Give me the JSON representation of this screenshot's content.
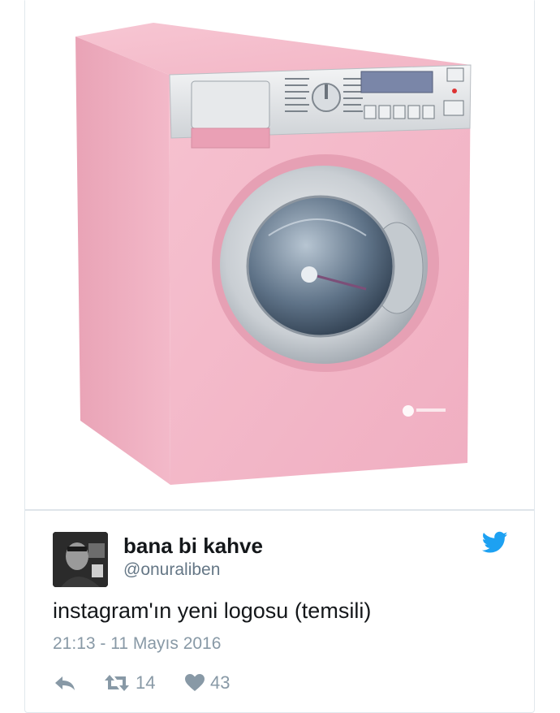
{
  "tweet": {
    "display_name": "bana bi kahve",
    "handle": "@onuraliben",
    "text": "instagram'ın yeni logosu (temsili)",
    "timestamp": "21:13 - 11 Mayıs 2016",
    "retweet_count": "14",
    "like_count": "43"
  },
  "icons": {
    "brand": "twitter-bird-icon",
    "reply": "reply-icon",
    "retweet": "retweet-icon",
    "like": "heart-icon"
  },
  "colors": {
    "twitter_blue": "#1da1f2",
    "text_primary": "#14171a",
    "text_secondary": "#657786",
    "icon_gray": "#8899a6",
    "machine_pink": "#f2b6c6"
  }
}
